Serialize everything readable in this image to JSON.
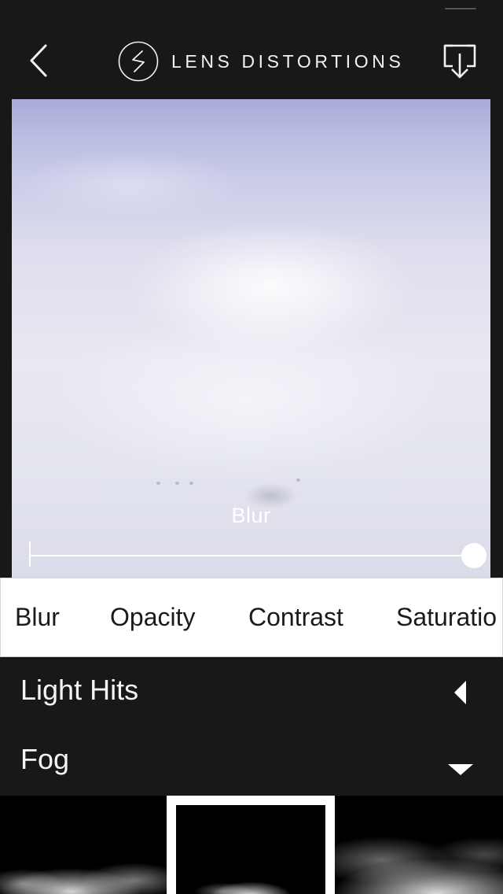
{
  "app": {
    "title": "LENS DISTORTIONS"
  },
  "header": {
    "back_icon": "chevron-left-icon",
    "logo_icon": "lens-distortions-logo",
    "download_icon": "download-icon"
  },
  "preview": {
    "slider": {
      "label": "Blur",
      "value": 1.0
    }
  },
  "adjustment_tabs": [
    {
      "label": "Blur",
      "selected": true
    },
    {
      "label": "Opacity",
      "selected": false
    },
    {
      "label": "Contrast",
      "selected": false
    },
    {
      "label": "Saturatio",
      "selected": false
    }
  ],
  "categories": [
    {
      "label": "Light Hits",
      "state": "collapsed",
      "icon": "triangle-left-icon"
    },
    {
      "label": "Fog",
      "state": "expanded",
      "icon": "triangle-down-icon"
    }
  ],
  "thumbnails": [
    {
      "name": "fog-thumbnail-1",
      "selected": false
    },
    {
      "name": "fog-thumbnail-2",
      "selected": true
    },
    {
      "name": "fog-thumbnail-3",
      "selected": false
    }
  ],
  "colors": {
    "background": "#181818",
    "text_light": "#f4f4f4",
    "tabbar_bg": "#ffffff",
    "tab_text": "#1a1a1a"
  }
}
